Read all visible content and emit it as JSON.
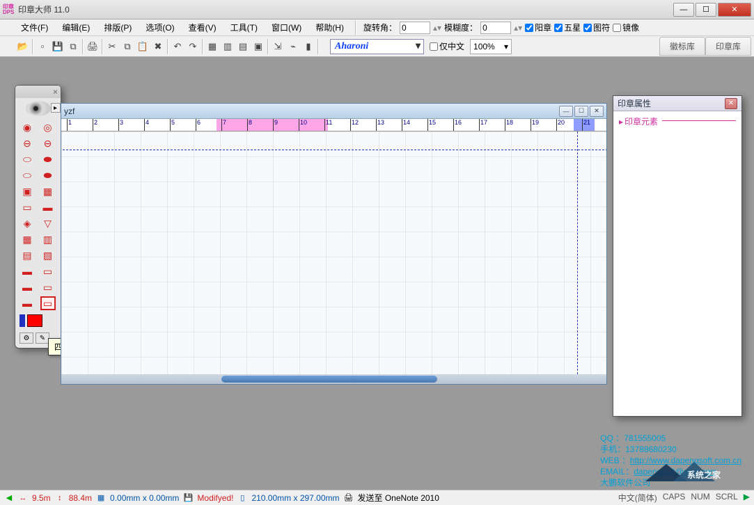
{
  "app": {
    "title": "印章大师 11.0",
    "icon_text": "印章\nDPS"
  },
  "window_controls": {
    "min": "—",
    "max": "☐",
    "close": "✕"
  },
  "menus": [
    "文件(F)",
    "编辑(E)",
    "排版(P)",
    "选项(O)",
    "查看(V)",
    "工具(T)",
    "窗口(W)",
    "帮助(H)"
  ],
  "options_bar": {
    "rotate_label": "旋转角：",
    "rotate_value": "0",
    "blur_label": "模糊度：",
    "blur_value": "0",
    "checks": [
      {
        "label": "阳章",
        "checked": true
      },
      {
        "label": "五星",
        "checked": true
      },
      {
        "label": "图符",
        "checked": true
      },
      {
        "label": "镜像",
        "checked": false
      }
    ]
  },
  "toolbar2": {
    "font": "Aharoni",
    "cn_only": {
      "label": "仅中文",
      "checked": false
    },
    "zoom": "100%",
    "lib_tabs": [
      "徽标库",
      "印章库"
    ]
  },
  "palette": {
    "tooltip": "四字扁章",
    "footer_icons": [
      "⚙",
      "✎"
    ]
  },
  "document": {
    "title": "yzf",
    "ruler_marks": [
      "1",
      "2",
      "3",
      "4",
      "5",
      "6",
      "7",
      "8",
      "9",
      "10",
      "11",
      "12",
      "13",
      "14",
      "15",
      "16",
      "17",
      "18",
      "19",
      "20",
      "21"
    ]
  },
  "properties": {
    "title": "印章属性",
    "group": "印章元素"
  },
  "contact": {
    "qq_label": "QQ ：",
    "qq": "781555005",
    "mobile_label": "手机：",
    "mobile": "13788680230",
    "web_label": "WEB ：",
    "web": "http://www.dapengsoft.com.cn",
    "email_label": "EMAIL：",
    "email": "dapengsoft@sina.com",
    "company": "大鹏软件公司"
  },
  "status": {
    "x": "9.5m",
    "y": "88.4m",
    "mouse": "0.00mm x 0.00mm",
    "modified": "Modifyed!",
    "page": "210.00mm x 297.00mm",
    "send": "发送至 OneNote 2010",
    "ime": "中文(简体)",
    "indicators": [
      "CAPS",
      "NUM",
      "SCRL"
    ]
  },
  "watermark": "系统之家"
}
